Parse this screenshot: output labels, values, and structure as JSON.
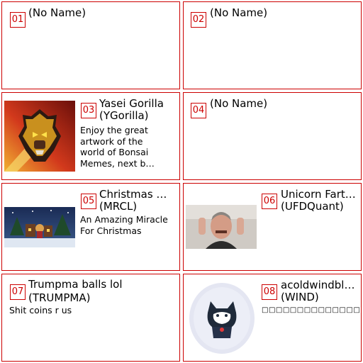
{
  "cards": [
    {
      "num": "01",
      "name": "(No Name)",
      "ticker": "",
      "desc": ""
    },
    {
      "num": "02",
      "name": "(No Name)",
      "ticker": "",
      "desc": ""
    },
    {
      "num": "03",
      "name": "Yasei Gorilla",
      "ticker": "(YGorilla)",
      "desc": "Enjoy the great artwork of the world of Bonsai Memes, next b…"
    },
    {
      "num": "04",
      "name": "(No Name)",
      "ticker": "",
      "desc": ""
    },
    {
      "num": "05",
      "name": "Christmas …",
      "ticker": "(MRCL)",
      "desc": "An Amazing Miracle For Christmas"
    },
    {
      "num": "06",
      "name": "Unicorn Fart…",
      "ticker": "(UFDQuant)",
      "desc": ""
    },
    {
      "num": "07",
      "name": "Trumpma balls lol",
      "ticker": "(TRUMPMA)",
      "desc": "Shit coins r us"
    },
    {
      "num": "08",
      "name": "acoldwindbl…",
      "ticker": "(WIND)",
      "desc": "□□□□□□□□□□□□□□□"
    }
  ],
  "colors": {
    "border": "#cc0000",
    "badge_text": "#cc0000"
  }
}
